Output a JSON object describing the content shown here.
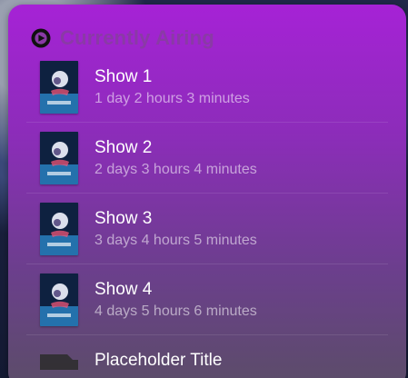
{
  "widget": {
    "title": "Currently Airing",
    "colors": {
      "gradient_top": "#a622d6",
      "gradient_bottom": "#5b4d68",
      "title": "#8a3aa6",
      "text_primary": "#ffffff",
      "text_secondary": "rgba(255,255,255,0.55)"
    },
    "logo_icon": "play-disc-icon",
    "items": [
      {
        "title": "Show 1",
        "time": "1 day 2 hours 3 minutes"
      },
      {
        "title": "Show 2",
        "time": "2 days 3 hours 4 minutes"
      },
      {
        "title": "Show 3",
        "time": "3 days 4 hours 5 minutes"
      },
      {
        "title": "Show 4",
        "time": "4 days 5 hours 6 minutes"
      }
    ],
    "placeholder": {
      "title": "Placeholder Title"
    }
  }
}
